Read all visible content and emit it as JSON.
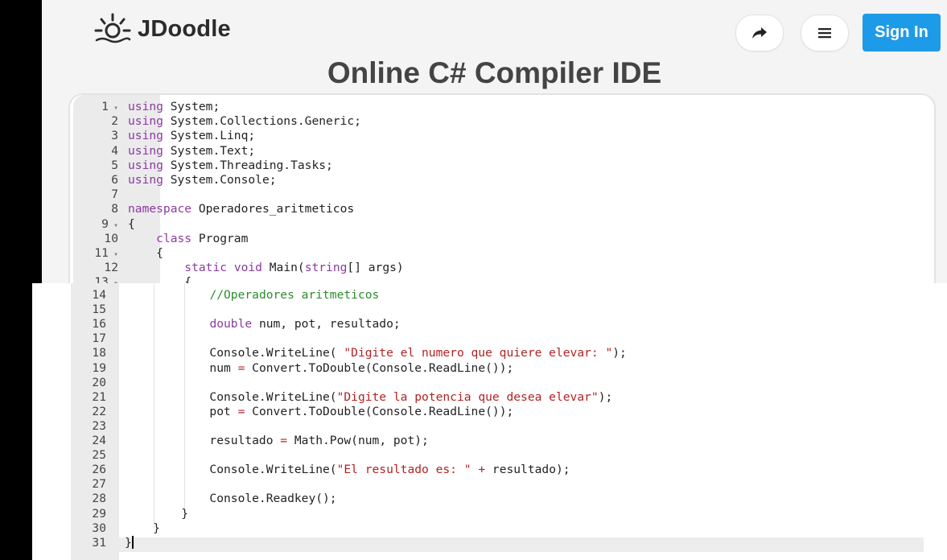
{
  "header": {
    "logo_text": "JDoodle",
    "share_icon": "share-arrow-icon",
    "menu_icon": "hamburger-menu-icon",
    "signin_label": "Sign In"
  },
  "page_title": "Online C# Compiler IDE",
  "colors": {
    "accent": "#1e9be8",
    "keyword": "#8a3aa0",
    "string": "#b22222",
    "comment": "#2e8b2e"
  },
  "editor": {
    "lines_top": [
      {
        "n": "1",
        "fold": true,
        "tokens": [
          {
            "t": "kw",
            "v": "using"
          },
          {
            "t": "",
            "v": " System;"
          }
        ]
      },
      {
        "n": "2",
        "tokens": [
          {
            "t": "kw",
            "v": "using"
          },
          {
            "t": "",
            "v": " System.Collections.Generic;"
          }
        ]
      },
      {
        "n": "3",
        "tokens": [
          {
            "t": "kw",
            "v": "using"
          },
          {
            "t": "",
            "v": " System.Linq;"
          }
        ]
      },
      {
        "n": "4",
        "tokens": [
          {
            "t": "kw",
            "v": "using"
          },
          {
            "t": "",
            "v": " System.Text;"
          }
        ]
      },
      {
        "n": "5",
        "tokens": [
          {
            "t": "kw",
            "v": "using"
          },
          {
            "t": "",
            "v": " System.Threading.Tasks;"
          }
        ]
      },
      {
        "n": "6",
        "tokens": [
          {
            "t": "kw",
            "v": "using"
          },
          {
            "t": "",
            "v": " System.Console;"
          }
        ]
      },
      {
        "n": "7",
        "tokens": []
      },
      {
        "n": "8",
        "tokens": [
          {
            "t": "kw",
            "v": "namespace"
          },
          {
            "t": "",
            "v": " Operadores_aritmeticos"
          }
        ]
      },
      {
        "n": "9",
        "fold": true,
        "tokens": [
          {
            "t": "",
            "v": "{"
          }
        ]
      },
      {
        "n": "10",
        "tokens": [
          {
            "t": "",
            "v": "    "
          },
          {
            "t": "kw",
            "v": "class"
          },
          {
            "t": "",
            "v": " Program"
          }
        ]
      },
      {
        "n": "11",
        "fold": true,
        "tokens": [
          {
            "t": "",
            "v": "    {"
          }
        ]
      },
      {
        "n": "12",
        "tokens": [
          {
            "t": "",
            "v": "        "
          },
          {
            "t": "kw",
            "v": "static"
          },
          {
            "t": "",
            "v": " "
          },
          {
            "t": "kw",
            "v": "void"
          },
          {
            "t": "",
            "v": " Main("
          },
          {
            "t": "kw",
            "v": "string"
          },
          {
            "t": "",
            "v": "[] args)"
          }
        ]
      },
      {
        "n": "13",
        "fold": true,
        "tokens": [
          {
            "t": "",
            "v": "        {"
          }
        ]
      }
    ],
    "lines_bottom": [
      {
        "n": "14",
        "tokens": [
          {
            "t": "",
            "v": "            "
          },
          {
            "t": "cm",
            "v": "//Operadores aritmeticos"
          }
        ]
      },
      {
        "n": "15",
        "tokens": []
      },
      {
        "n": "16",
        "tokens": [
          {
            "t": "",
            "v": "            "
          },
          {
            "t": "kw",
            "v": "double"
          },
          {
            "t": "",
            "v": " num, pot, resultado;"
          }
        ]
      },
      {
        "n": "17",
        "tokens": []
      },
      {
        "n": "18",
        "tokens": [
          {
            "t": "",
            "v": "            Console.WriteLine( "
          },
          {
            "t": "str",
            "v": "\"Digite el numero que quiere elevar: \""
          },
          {
            "t": "",
            "v": ");"
          }
        ]
      },
      {
        "n": "19",
        "tokens": [
          {
            "t": "",
            "v": "            num "
          },
          {
            "t": "str",
            "v": "="
          },
          {
            "t": "",
            "v": " Convert.ToDouble(Console.ReadLine());"
          }
        ]
      },
      {
        "n": "20",
        "tokens": []
      },
      {
        "n": "21",
        "tokens": [
          {
            "t": "",
            "v": "            Console.WriteLine("
          },
          {
            "t": "str",
            "v": "\"Digite la potencia que desea elevar\""
          },
          {
            "t": "",
            "v": ");"
          }
        ]
      },
      {
        "n": "22",
        "tokens": [
          {
            "t": "",
            "v": "            pot "
          },
          {
            "t": "str",
            "v": "="
          },
          {
            "t": "",
            "v": " Convert.ToDouble(Console.ReadLine());"
          }
        ]
      },
      {
        "n": "23",
        "tokens": []
      },
      {
        "n": "24",
        "tokens": [
          {
            "t": "",
            "v": "            resultado "
          },
          {
            "t": "str",
            "v": "="
          },
          {
            "t": "",
            "v": " Math.Pow(num, pot);"
          }
        ]
      },
      {
        "n": "25",
        "tokens": []
      },
      {
        "n": "26",
        "tokens": [
          {
            "t": "",
            "v": "            Console.WriteLine("
          },
          {
            "t": "str",
            "v": "\"El resultado es: \""
          },
          {
            "t": "",
            "v": " "
          },
          {
            "t": "str",
            "v": "+"
          },
          {
            "t": "",
            "v": " resultado);"
          }
        ]
      },
      {
        "n": "27",
        "tokens": []
      },
      {
        "n": "28",
        "tokens": [
          {
            "t": "",
            "v": "            Console.Readkey();"
          }
        ]
      },
      {
        "n": "29",
        "tokens": [
          {
            "t": "",
            "v": "        }"
          }
        ]
      },
      {
        "n": "30",
        "tokens": [
          {
            "t": "",
            "v": "    }"
          }
        ]
      },
      {
        "n": "31",
        "cursor": true,
        "tokens": [
          {
            "t": "",
            "v": "}"
          }
        ]
      }
    ]
  }
}
